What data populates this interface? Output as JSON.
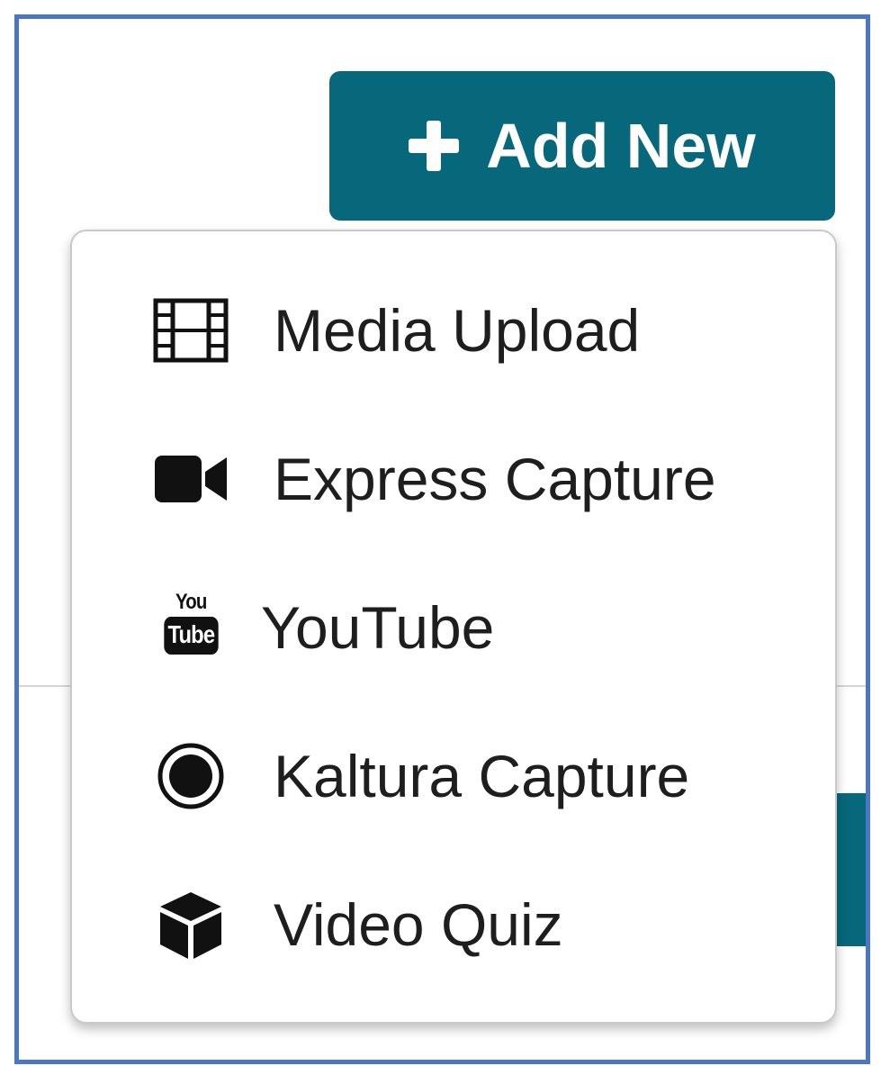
{
  "add_new_button": {
    "label": "Add New",
    "icon": "plus-icon",
    "color": "#06687a"
  },
  "menu": {
    "items": [
      {
        "id": "media-upload",
        "label": "Media Upload",
        "icon": "film-icon"
      },
      {
        "id": "express-capture",
        "label": "Express Capture",
        "icon": "video-camera-icon"
      },
      {
        "id": "youtube",
        "label": "YouTube",
        "icon": "youtube-icon",
        "icon_text_top": "You",
        "icon_text_bottom": "Tube"
      },
      {
        "id": "kaltura-capture",
        "label": "Kaltura Capture",
        "icon": "record-icon"
      },
      {
        "id": "video-quiz",
        "label": "Video Quiz",
        "icon": "cube-icon"
      }
    ]
  }
}
